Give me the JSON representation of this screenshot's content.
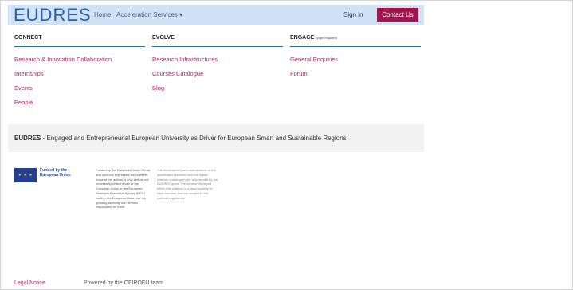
{
  "header": {
    "logo": "EUDRES",
    "nav": [
      "Home",
      "Acceleration Services ▾"
    ],
    "signin": "Sign in",
    "contact": "Contact Us"
  },
  "menu": {
    "columns": [
      {
        "title": "CONNECT",
        "note": "",
        "links": [
          "Research & Innovation Collaboration",
          "Internships",
          "Events",
          "People"
        ]
      },
      {
        "title": "EVOLVE",
        "note": "",
        "links": [
          "Research Infrastructures",
          "Courses Catalogue",
          "Blog"
        ]
      },
      {
        "title": "ENGAGE",
        "note": "(login required)",
        "links": [
          "General Enquiries",
          "Forum"
        ]
      }
    ]
  },
  "tagline": {
    "brand": "EUDRES",
    "text": " - Engaged and Entrepreneurial European University as Driver for European Smart and Sustainable Regions"
  },
  "footer": {
    "eu_label": "Funded by the European Union",
    "disclaimer1": "Funded by the European Union. Views and opinions expressed are however those of the author(s) only and do not necessarily reflect those of the European Union or the European Research Executive Agency (REA). Neither the European Union nor the granting authority can be held responsible for them.",
    "disclaimer2": "The development and maintenance of the acceleration services and the digital platform (catalogue) are fully funded by the EUDRES grant. The content displayed within this platform is a responsibility of each member and are subject to the national regulations.",
    "legal": "Legal Notice",
    "powered": "Powered by the OEIPOEU team"
  }
}
